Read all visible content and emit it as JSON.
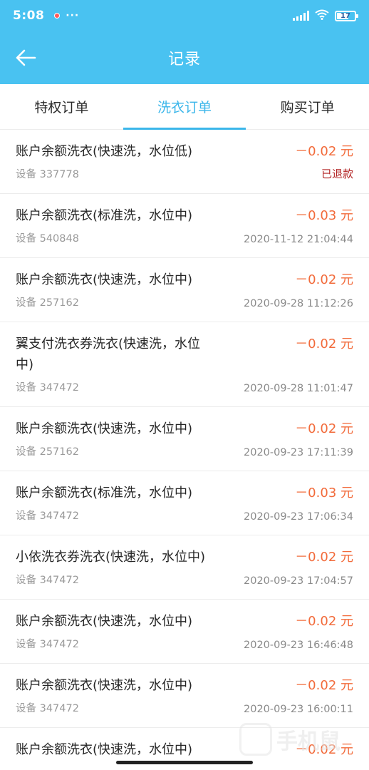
{
  "status_bar": {
    "time": "5:08",
    "more": "···",
    "battery": "17"
  },
  "header": {
    "title": "记录"
  },
  "tabs": [
    {
      "label": "特权订单",
      "active": false
    },
    {
      "label": "洗衣订单",
      "active": true
    },
    {
      "label": "购买订单",
      "active": false
    }
  ],
  "orders": [
    {
      "title": "账户余额洗衣(快速洗，水位低)",
      "amount": "－0.02 元",
      "device": "设备 337778",
      "meta": "已退款"
    },
    {
      "title": "账户余额洗衣(标准洗，水位中)",
      "amount": "－0.03 元",
      "device": "设备 540848",
      "meta": "2020-11-12 21:04:44"
    },
    {
      "title": "账户余额洗衣(快速洗，水位中)",
      "amount": "－0.02 元",
      "device": "设备 257162",
      "meta": "2020-09-28 11:12:26"
    },
    {
      "title": "翼支付洗衣券洗衣(快速洗，水位中)",
      "amount": "－0.02 元",
      "device": "设备 347472",
      "meta": "2020-09-28 11:01:47"
    },
    {
      "title": "账户余额洗衣(快速洗，水位中)",
      "amount": "－0.02 元",
      "device": "设备 257162",
      "meta": "2020-09-23 17:11:39"
    },
    {
      "title": "账户余额洗衣(标准洗，水位中)",
      "amount": "－0.03 元",
      "device": "设备 347472",
      "meta": "2020-09-23 17:06:34"
    },
    {
      "title": "小依洗衣券洗衣(快速洗，水位中)",
      "amount": "－0.02 元",
      "device": "设备 347472",
      "meta": "2020-09-23 17:04:57"
    },
    {
      "title": "账户余额洗衣(快速洗，水位中)",
      "amount": "－0.02 元",
      "device": "设备 347472",
      "meta": "2020-09-23 16:46:48"
    },
    {
      "title": "账户余额洗衣(快速洗，水位中)",
      "amount": "－0.02 元",
      "device": "设备 347472",
      "meta": "2020-09-23 16:00:11"
    },
    {
      "title": "账户余额洗衣(快速洗，水位中)",
      "amount": "－0.02 元"
    }
  ],
  "watermark": {
    "text": "手机鼠"
  },
  "colors": {
    "primary": "#49c2f1",
    "active_tab": "#3bb6ea",
    "amount": "#f26b3b",
    "refunded": "#b22222"
  }
}
